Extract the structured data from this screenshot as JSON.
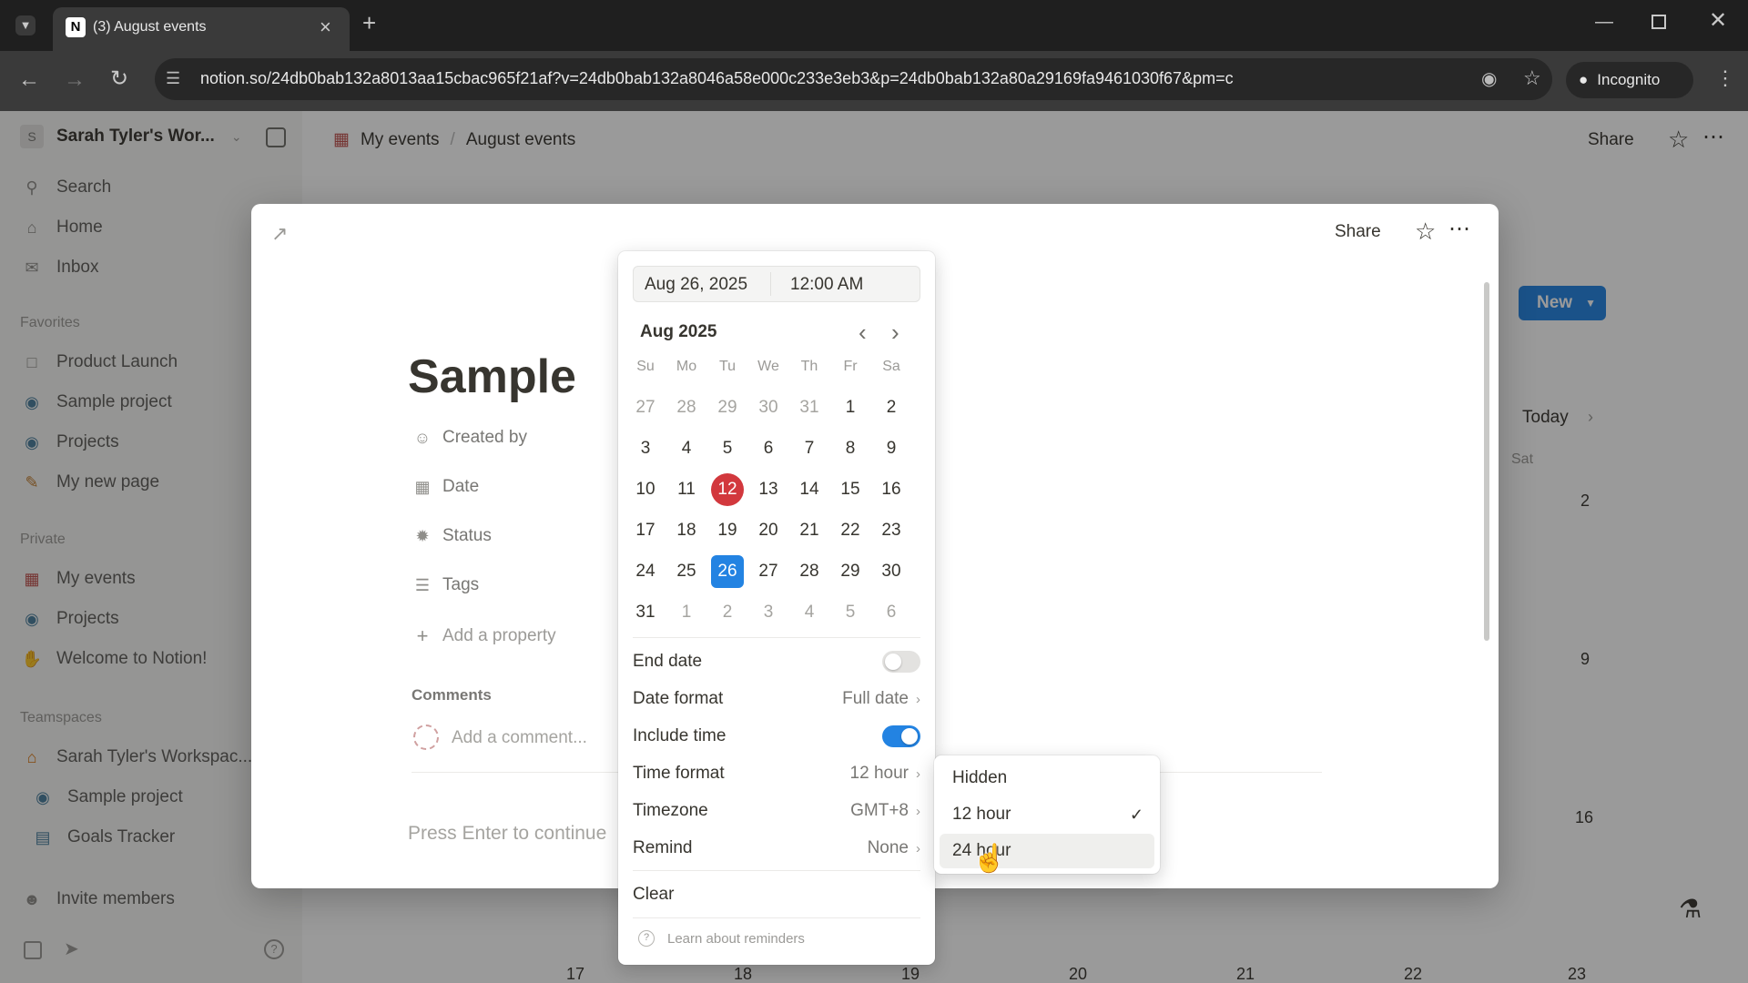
{
  "browser": {
    "tab_title": "(3) August events",
    "url": "notion.so/24db0bab132a8013aa15cbac965f21af?v=24db0bab132a8046a58e000c233e3eb3&p=24db0bab132a80a29169fa9461030f67&pm=c",
    "incognito_label": "Incognito"
  },
  "sidebar": {
    "workspace_name": "Sarah Tyler's Wor...",
    "workspace_initial": "S",
    "nav": [
      {
        "label": "Search",
        "icon": "search-icon"
      },
      {
        "label": "Home",
        "icon": "home-icon"
      },
      {
        "label": "Inbox",
        "icon": "inbox-icon"
      }
    ],
    "favorites_label": "Favorites",
    "favorites": [
      {
        "label": "Product Launch",
        "icon": "page-icon"
      },
      {
        "label": "Sample project",
        "icon": "database-icon"
      },
      {
        "label": "Projects",
        "icon": "database-icon"
      },
      {
        "label": "My new page",
        "icon": "pencil-icon"
      }
    ],
    "private_label": "Private",
    "private": [
      {
        "label": "My events",
        "icon": "calendar-icon"
      },
      {
        "label": "Projects",
        "icon": "database-icon"
      },
      {
        "label": "Welcome to Notion!",
        "icon": "wave-icon"
      }
    ],
    "teamspaces_label": "Teamspaces",
    "teamspaces": [
      {
        "label": "Sarah Tyler's Workspac...",
        "icon": "house-icon"
      },
      {
        "label": "Sample project",
        "icon": "database-icon"
      },
      {
        "label": "Goals Tracker",
        "icon": "chart-icon"
      }
    ],
    "invite_label": "Invite members"
  },
  "topbar": {
    "breadcrumb": [
      "My events",
      "August events"
    ],
    "share_label": "Share"
  },
  "background": {
    "new_label": "New",
    "today_label": "Today",
    "sat_label": "Sat",
    "week_numbers": [
      "2",
      "9",
      "16"
    ],
    "bottom_dates": [
      "17",
      "18",
      "19",
      "20",
      "21",
      "22",
      "23"
    ]
  },
  "modal": {
    "share_label": "Share",
    "title": "Sample",
    "properties": [
      {
        "label": "Created by",
        "icon": "person-icon"
      },
      {
        "label": "Date",
        "icon": "calendar-icon"
      },
      {
        "label": "Status",
        "icon": "status-icon"
      },
      {
        "label": "Tags",
        "icon": "list-icon"
      }
    ],
    "add_property": "Add a property",
    "comments_label": "Comments",
    "comment_placeholder": "Add a comment...",
    "body_placeholder": "Press Enter to continue"
  },
  "datepicker": {
    "date_value": "Aug 26, 2025",
    "time_value": "12:00 AM",
    "month_label": "Aug 2025",
    "weekdays": [
      "Su",
      "Mo",
      "Tu",
      "We",
      "Th",
      "Fr",
      "Sa"
    ],
    "weeks": [
      [
        "27",
        "28",
        "29",
        "30",
        "31",
        "1",
        "2"
      ],
      [
        "3",
        "4",
        "5",
        "6",
        "7",
        "8",
        "9"
      ],
      [
        "10",
        "11",
        "12",
        "13",
        "14",
        "15",
        "16"
      ],
      [
        "17",
        "18",
        "19",
        "20",
        "21",
        "22",
        "23"
      ],
      [
        "24",
        "25",
        "26",
        "27",
        "28",
        "29",
        "30"
      ],
      [
        "31",
        "1",
        "2",
        "3",
        "4",
        "5",
        "6"
      ]
    ],
    "today_day": "12",
    "selected_day": "26",
    "end_date_label": "End date",
    "end_date_on": false,
    "date_format_label": "Date format",
    "date_format_value": "Full date",
    "include_time_label": "Include time",
    "include_time_on": true,
    "time_format_label": "Time format",
    "time_format_value": "12 hour",
    "timezone_label": "Timezone",
    "timezone_value": "GMT+8",
    "remind_label": "Remind",
    "remind_value": "None",
    "clear_label": "Clear",
    "learn_label": "Learn about reminders"
  },
  "time_format_menu": {
    "options": [
      "Hidden",
      "12 hour",
      "24 hour"
    ],
    "checked": "12 hour",
    "hovered": "24 hour"
  },
  "colors": {
    "accent": "#2383e2",
    "today": "#d2383d",
    "new_button": "#2383e2"
  }
}
